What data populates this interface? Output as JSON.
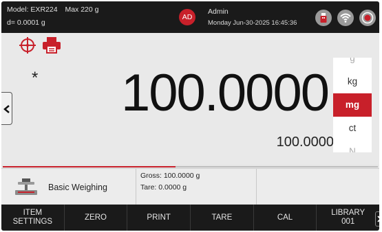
{
  "header": {
    "model": "Model: EXR224",
    "max_capacity": "Max 220 g",
    "readability": "d= 0.0001 g",
    "avatar_initials": "AD",
    "user_name": "Admin",
    "datetime": "Monday Jun-30-2025 16:45:36",
    "icons": [
      "usb-icon",
      "wifi-icon",
      "alibi-icon"
    ]
  },
  "display": {
    "stability_mark": "*",
    "weight": "100.0000",
    "secondary_weight": "100.0000",
    "units": [
      "g",
      "kg",
      "mg",
      "ct",
      "N"
    ],
    "selected_unit": "mg",
    "progress_fraction": 0.46
  },
  "info": {
    "application": "Basic Weighing",
    "gross": "Gross: 100.0000 g",
    "tare": "Tare: 0.0000 g"
  },
  "function_keys": {
    "item_settings_1": "ITEM",
    "item_settings_2": "SETTINGS",
    "zero": "ZERO",
    "print": "PRINT",
    "tare": "TARE",
    "cal": "CAL",
    "library_1": "LIBRARY",
    "library_2": "001"
  },
  "colors": {
    "accent": "#c8202a",
    "bar_background": "#1a1a1a",
    "screen_background": "#e6e6e6"
  }
}
